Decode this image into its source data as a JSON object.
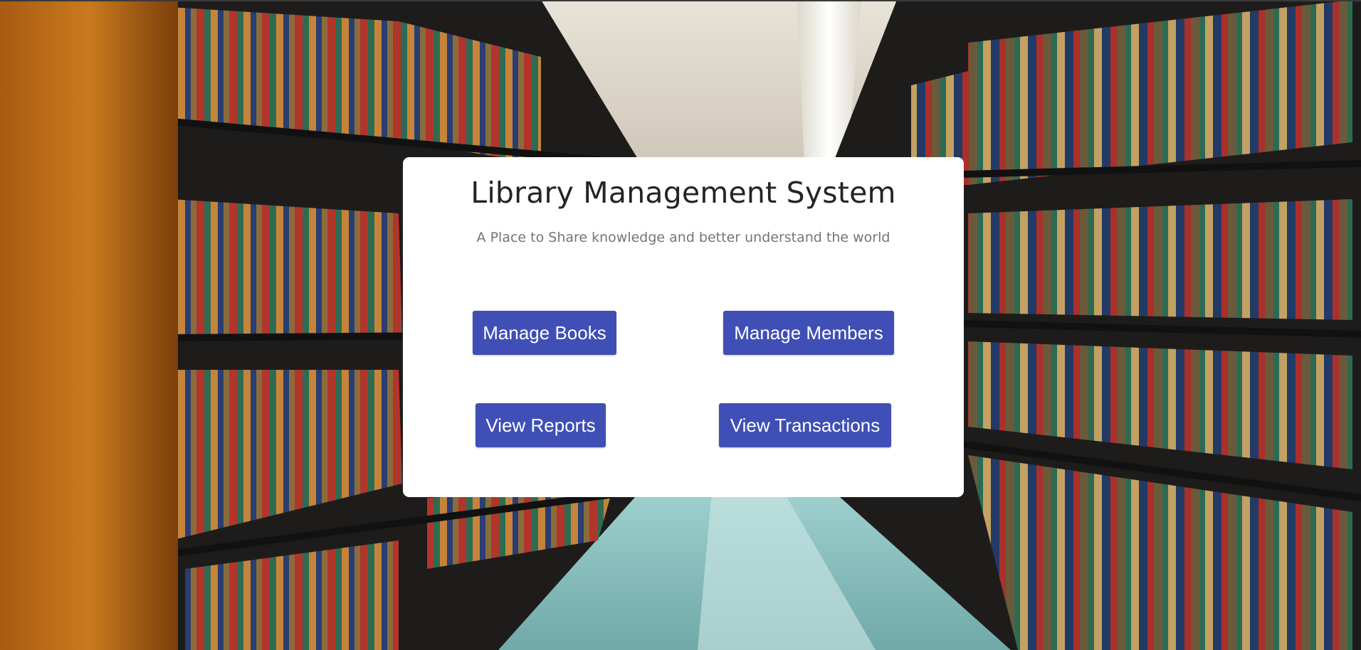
{
  "app": {
    "title": "Library Management System",
    "subtitle": "A Place to Share knowledge and better understand the world"
  },
  "actions": {
    "manage_books": "Manage Books",
    "manage_members": "Manage Members",
    "view_reports": "View Reports",
    "view_transactions": "View Transactions"
  },
  "colors": {
    "button_bg": "#3f4fb5",
    "button_text": "#ffffff",
    "card_bg": "#ffffff",
    "title_text": "#222428",
    "subtitle_text": "#71757b"
  },
  "background": {
    "icon": "library-bookshelves-photo"
  }
}
